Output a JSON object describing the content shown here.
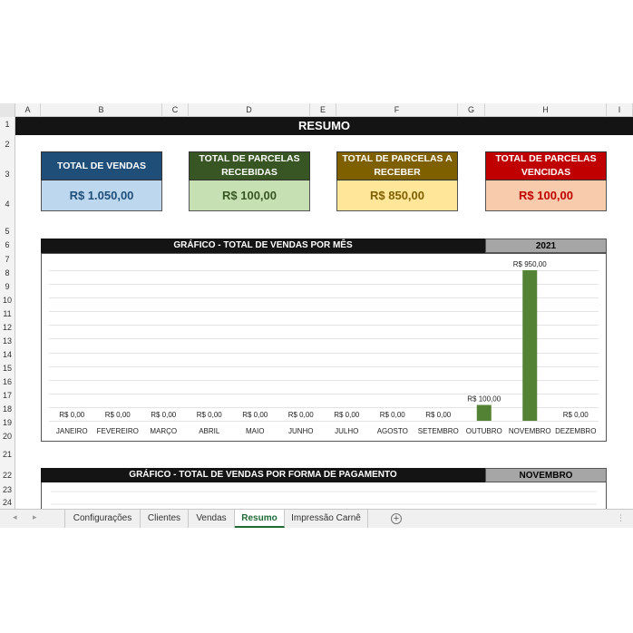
{
  "columns": [
    "A",
    "B",
    "C",
    "D",
    "E",
    "F",
    "G",
    "H",
    "I"
  ],
  "rows": [
    "1",
    "2",
    "3",
    "4",
    "5",
    "6",
    "7",
    "8",
    "9",
    "10",
    "11",
    "12",
    "13",
    "14",
    "15",
    "16",
    "17",
    "18",
    "19",
    "20",
    "21",
    "22",
    "23",
    "24"
  ],
  "title": "RESUMO",
  "kpis": [
    {
      "title": "TOTAL DE VENDAS",
      "value": "R$ 1.050,00",
      "header_color": "#1f4e79",
      "value_bg": "#bdd7ee",
      "value_color": "#1f4e79"
    },
    {
      "title": "TOTAL DE PARCELAS RECEBIDAS",
      "value": "R$ 100,00",
      "header_color": "#375623",
      "value_bg": "#c6e0b4",
      "value_color": "#375623"
    },
    {
      "title": "TOTAL DE PARCELAS A RECEBER",
      "value": "R$ 850,00",
      "header_color": "#7f6000",
      "value_bg": "#ffe699",
      "value_color": "#7f6000"
    },
    {
      "title": "TOTAL DE PARCELAS VENCIDAS",
      "value": "R$ 100,00",
      "header_color": "#c00000",
      "value_bg": "#f8cbad",
      "value_color": "#c00000"
    }
  ],
  "chart_section": {
    "title": "GRÁFICO - TOTAL DE VENDAS POR MÊS",
    "year": "2021"
  },
  "chart_data": {
    "type": "bar",
    "categories": [
      "JANEIRO",
      "FEVEREIRO",
      "MARÇO",
      "ABRIL",
      "MAIO",
      "JUNHO",
      "JULHO",
      "AGOSTO",
      "SETEMBRO",
      "OUTUBRO",
      "NOVEMBRO",
      "DEZEMBRO"
    ],
    "values": [
      0,
      0,
      0,
      0,
      0,
      0,
      0,
      0,
      0,
      100,
      950,
      0
    ],
    "data_labels": [
      "R$ 0,00",
      "R$ 0,00",
      "R$ 0,00",
      "R$ 0,00",
      "R$ 0,00",
      "R$ 0,00",
      "R$ 0,00",
      "R$ 0,00",
      "R$ 0,00",
      "R$ 100,00",
      "R$ 950,00",
      "R$ 0,00"
    ],
    "ylim": [
      0,
      950
    ],
    "grid": true,
    "bar_color": "#548235"
  },
  "chart2_section": {
    "title": "GRÁFICO - TOTAL DE VENDAS POR FORMA DE PAGAMENTO",
    "month": "NOVEMBRO"
  },
  "sheet_tabs": [
    "Configurações",
    "Clientes",
    "Vendas",
    "Resumo",
    "Impressão Carnê"
  ],
  "active_tab": "Resumo"
}
